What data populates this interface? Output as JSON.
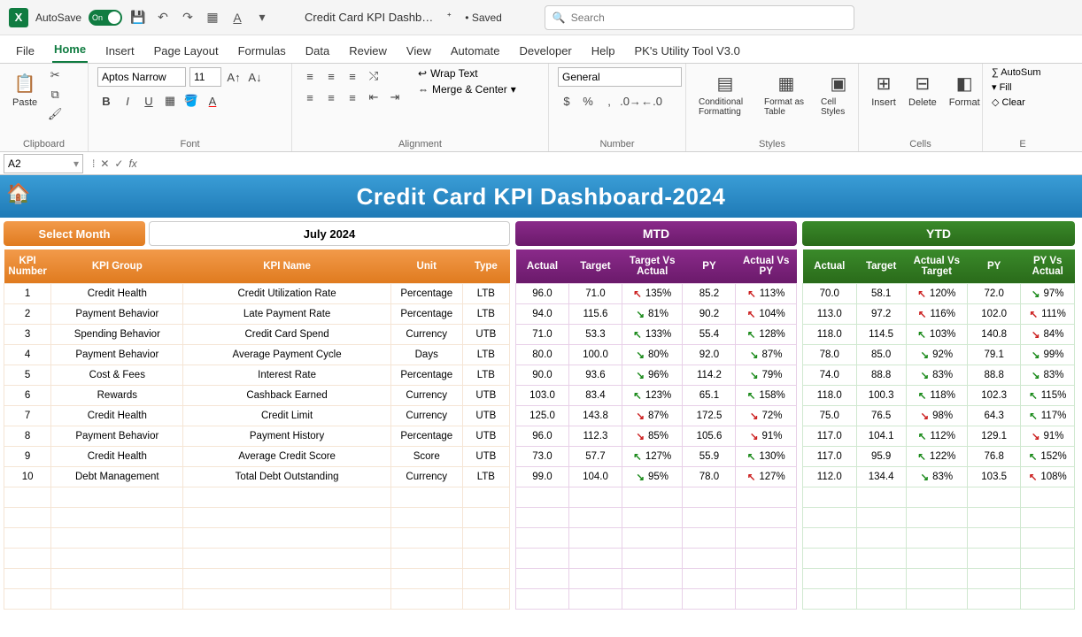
{
  "titlebar": {
    "autosave_label": "AutoSave",
    "autosave_state": "On",
    "filename": "Credit Card KPI Dashb…",
    "saved_status": "• Saved",
    "search_placeholder": "Search"
  },
  "menu": {
    "tabs": [
      "File",
      "Home",
      "Insert",
      "Page Layout",
      "Formulas",
      "Data",
      "Review",
      "View",
      "Automate",
      "Developer",
      "Help",
      "PK's Utility Tool V3.0"
    ],
    "active": "Home"
  },
  "ribbon": {
    "paste": "Paste",
    "clipboard_label": "Clipboard",
    "font_name": "Aptos Narrow",
    "font_size": "11",
    "font_label": "Font",
    "alignment_label": "Alignment",
    "wrap_text": "Wrap Text",
    "merge_center": "Merge & Center",
    "number_format": "General",
    "number_label": "Number",
    "cond_fmt": "Conditional Formatting",
    "fmt_table": "Format as Table",
    "cell_styles": "Cell Styles",
    "styles_label": "Styles",
    "insert": "Insert",
    "delete": "Delete",
    "format": "Format",
    "cells_label": "Cells",
    "autosum": "AutoSum",
    "fill": "Fill",
    "clear": "Clear"
  },
  "formula_bar": {
    "cell_ref": "A2",
    "formula": ""
  },
  "dashboard": {
    "title": "Credit Card KPI Dashboard-2024",
    "select_month_label": "Select Month",
    "selected_month": "July 2024",
    "mtd_label": "MTD",
    "ytd_label": "YTD"
  },
  "headers": {
    "left": [
      "KPI Number",
      "KPI Group",
      "KPI Name",
      "Unit",
      "Type"
    ],
    "mtd": [
      "Actual",
      "Target",
      "Target Vs Actual",
      "PY",
      "Actual Vs PY"
    ],
    "ytd": [
      "Actual",
      "Target",
      "Actual Vs Target",
      "PY",
      "PY Vs Actual"
    ]
  },
  "rows": [
    {
      "num": "1",
      "group": "Credit Health",
      "name": "Credit Utilization Rate",
      "unit": "Percentage",
      "type": "LTB",
      "mtd": {
        "actual": "96.0",
        "target": "71.0",
        "tva": "135%",
        "tva_d": "up-r",
        "py": "85.2",
        "avp": "113%",
        "avp_d": "up-r"
      },
      "ytd": {
        "actual": "70.0",
        "target": "58.1",
        "avt": "120%",
        "avt_d": "up-r",
        "py": "72.0",
        "pva": "97%",
        "pva_d": "dn-g"
      }
    },
    {
      "num": "2",
      "group": "Payment Behavior",
      "name": "Late Payment Rate",
      "unit": "Percentage",
      "type": "LTB",
      "mtd": {
        "actual": "94.0",
        "target": "115.6",
        "tva": "81%",
        "tva_d": "dn-g",
        "py": "90.2",
        "avp": "104%",
        "avp_d": "up-r"
      },
      "ytd": {
        "actual": "113.0",
        "target": "97.2",
        "avt": "116%",
        "avt_d": "up-r",
        "py": "102.0",
        "pva": "111%",
        "pva_d": "up-r"
      }
    },
    {
      "num": "3",
      "group": "Spending Behavior",
      "name": "Credit Card Spend",
      "unit": "Currency",
      "type": "UTB",
      "mtd": {
        "actual": "71.0",
        "target": "53.3",
        "tva": "133%",
        "tva_d": "up-g",
        "py": "55.4",
        "avp": "128%",
        "avp_d": "up-g"
      },
      "ytd": {
        "actual": "118.0",
        "target": "114.5",
        "avt": "103%",
        "avt_d": "up-g",
        "py": "140.8",
        "pva": "84%",
        "pva_d": "dn-r"
      }
    },
    {
      "num": "4",
      "group": "Payment Behavior",
      "name": "Average Payment Cycle",
      "unit": "Days",
      "type": "LTB",
      "mtd": {
        "actual": "80.0",
        "target": "100.0",
        "tva": "80%",
        "tva_d": "dn-g",
        "py": "92.0",
        "avp": "87%",
        "avp_d": "dn-g"
      },
      "ytd": {
        "actual": "78.0",
        "target": "85.0",
        "avt": "92%",
        "avt_d": "dn-g",
        "py": "79.1",
        "pva": "99%",
        "pva_d": "dn-g"
      }
    },
    {
      "num": "5",
      "group": "Cost & Fees",
      "name": "Interest Rate",
      "unit": "Percentage",
      "type": "LTB",
      "mtd": {
        "actual": "90.0",
        "target": "93.6",
        "tva": "96%",
        "tva_d": "dn-g",
        "py": "114.2",
        "avp": "79%",
        "avp_d": "dn-g"
      },
      "ytd": {
        "actual": "74.0",
        "target": "88.8",
        "avt": "83%",
        "avt_d": "dn-g",
        "py": "88.8",
        "pva": "83%",
        "pva_d": "dn-g"
      }
    },
    {
      "num": "6",
      "group": "Rewards",
      "name": "Cashback Earned",
      "unit": "Currency",
      "type": "UTB",
      "mtd": {
        "actual": "103.0",
        "target": "83.4",
        "tva": "123%",
        "tva_d": "up-g",
        "py": "65.1",
        "avp": "158%",
        "avp_d": "up-g"
      },
      "ytd": {
        "actual": "118.0",
        "target": "100.3",
        "avt": "118%",
        "avt_d": "up-g",
        "py": "102.3",
        "pva": "115%",
        "pva_d": "up-g"
      }
    },
    {
      "num": "7",
      "group": "Credit Health",
      "name": "Credit Limit",
      "unit": "Currency",
      "type": "UTB",
      "mtd": {
        "actual": "125.0",
        "target": "143.8",
        "tva": "87%",
        "tva_d": "dn-r",
        "py": "172.5",
        "avp": "72%",
        "avp_d": "dn-r"
      },
      "ytd": {
        "actual": "75.0",
        "target": "76.5",
        "avt": "98%",
        "avt_d": "dn-r",
        "py": "64.3",
        "pva": "117%",
        "pva_d": "up-g"
      }
    },
    {
      "num": "8",
      "group": "Payment Behavior",
      "name": "Payment History",
      "unit": "Percentage",
      "type": "UTB",
      "mtd": {
        "actual": "96.0",
        "target": "112.3",
        "tva": "85%",
        "tva_d": "dn-r",
        "py": "105.6",
        "avp": "91%",
        "avp_d": "dn-r"
      },
      "ytd": {
        "actual": "117.0",
        "target": "104.1",
        "avt": "112%",
        "avt_d": "up-g",
        "py": "129.1",
        "pva": "91%",
        "pva_d": "dn-r"
      }
    },
    {
      "num": "9",
      "group": "Credit Health",
      "name": "Average Credit Score",
      "unit": "Score",
      "type": "UTB",
      "mtd": {
        "actual": "73.0",
        "target": "57.7",
        "tva": "127%",
        "tva_d": "up-g",
        "py": "55.9",
        "avp": "130%",
        "avp_d": "up-g"
      },
      "ytd": {
        "actual": "117.0",
        "target": "95.9",
        "avt": "122%",
        "avt_d": "up-g",
        "py": "76.8",
        "pva": "152%",
        "pva_d": "up-g"
      }
    },
    {
      "num": "10",
      "group": "Debt Management",
      "name": "Total Debt Outstanding",
      "unit": "Currency",
      "type": "LTB",
      "mtd": {
        "actual": "99.0",
        "target": "104.0",
        "tva": "95%",
        "tva_d": "dn-g",
        "py": "78.0",
        "avp": "127%",
        "avp_d": "up-r"
      },
      "ytd": {
        "actual": "112.0",
        "target": "134.4",
        "avt": "83%",
        "avt_d": "dn-g",
        "py": "103.5",
        "pva": "108%",
        "pva_d": "up-r"
      }
    }
  ]
}
